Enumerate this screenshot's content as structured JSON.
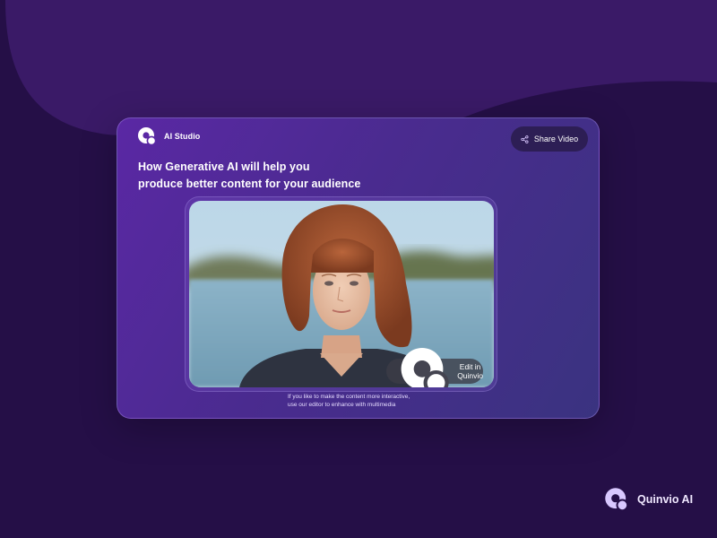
{
  "app": {
    "name": "AI Studio"
  },
  "header": {
    "share_label": "Share Video"
  },
  "headline": {
    "line1": "How Generative AI will help you",
    "line2": "produce better content for your audience"
  },
  "video": {
    "edit_label": "Edit in Quinvio"
  },
  "caption": {
    "line1": "If you like to make the content more interactive,",
    "line2": "use our editor to enhance with multimedia"
  },
  "footer": {
    "brand": "Quinvio AI"
  },
  "icons": {
    "logo": "quinvio-logo-icon",
    "share": "share-icon",
    "edit": "quinvio-logo-icon"
  },
  "colors": {
    "background": "#250f47",
    "wave": "#3a1a67",
    "card_start": "#5a28a4",
    "card_end": "#3a3380",
    "button_dark": "#2d1e55",
    "accent_light": "#d9c8ff"
  }
}
